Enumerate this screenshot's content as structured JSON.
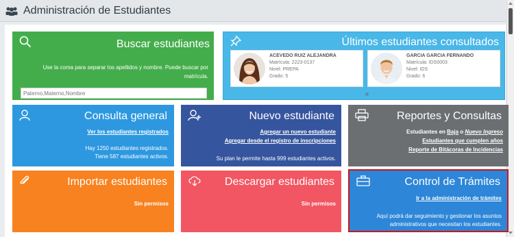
{
  "header": {
    "title": "Administración de Estudiantes"
  },
  "buscar": {
    "title": "Buscar estudiantes",
    "description": "Use la coma para separar los apellidos y nombre. Puede buscar por matrícula.",
    "placeholder": "Paterno,Materno,Nombre"
  },
  "ultimos": {
    "title": "Últimos estudiantes consultados",
    "students": [
      {
        "name": "ACEVEDO RUIZ ALEJANDRA",
        "matricula": "Matrícula: 2223-0137",
        "nivel": "Nivel: PREPA",
        "grado": "Grado: 5"
      },
      {
        "name": "GARCIA GARCIA FERNANDO",
        "matricula": "Matrícula: IDS0003",
        "nivel": "Nivel: IDS",
        "grado": "Grado: 6"
      }
    ]
  },
  "consulta": {
    "title": "Consulta general",
    "link": "Ver los estudiantes registrados",
    "line1": "Hay 1250 estudiantes registrados.",
    "line2": "Tiene 587 estudiantes activos."
  },
  "nuevo": {
    "title": "Nuevo estudiante",
    "link1": "Agregar un nuevo estudiante",
    "link2": "Agregar desde el registro de inscripciones",
    "note": "Su plan le permite hasta 999 estudiantes activos."
  },
  "reportes": {
    "title": "Reportes y Consultas",
    "line1_prefix": "Estudiantes en",
    "line1_baja": "Baja",
    "line1_mid": "o",
    "line1_nuevo": "Nuevo Ingreso",
    "link2": "Estudiantes que cumplen años",
    "link3": "Reporte de Bitácoras de Incidencias"
  },
  "importar": {
    "title": "Importar estudiantes",
    "status": "Sin permisos"
  },
  "descargar": {
    "title": "Descargar estudiantes",
    "status": "Sin permisos"
  },
  "control": {
    "title": "Control de Trámites",
    "link": "Ir a la administración de trámites",
    "line1": "Aquí podrá dar seguimiento y gestionar los asuntos",
    "line2": "administrativos que necesitan los estudiantes."
  },
  "colors": {
    "buscar": "#44ad4b",
    "ultimos": "#49b7e7",
    "consulta": "#2d98e0",
    "nuevo": "#35559e",
    "reportes": "#6b6f72",
    "importar": "#f7821f",
    "descargar": "#f25662",
    "control": "#2d86d8",
    "highlight": "#cc1818"
  }
}
